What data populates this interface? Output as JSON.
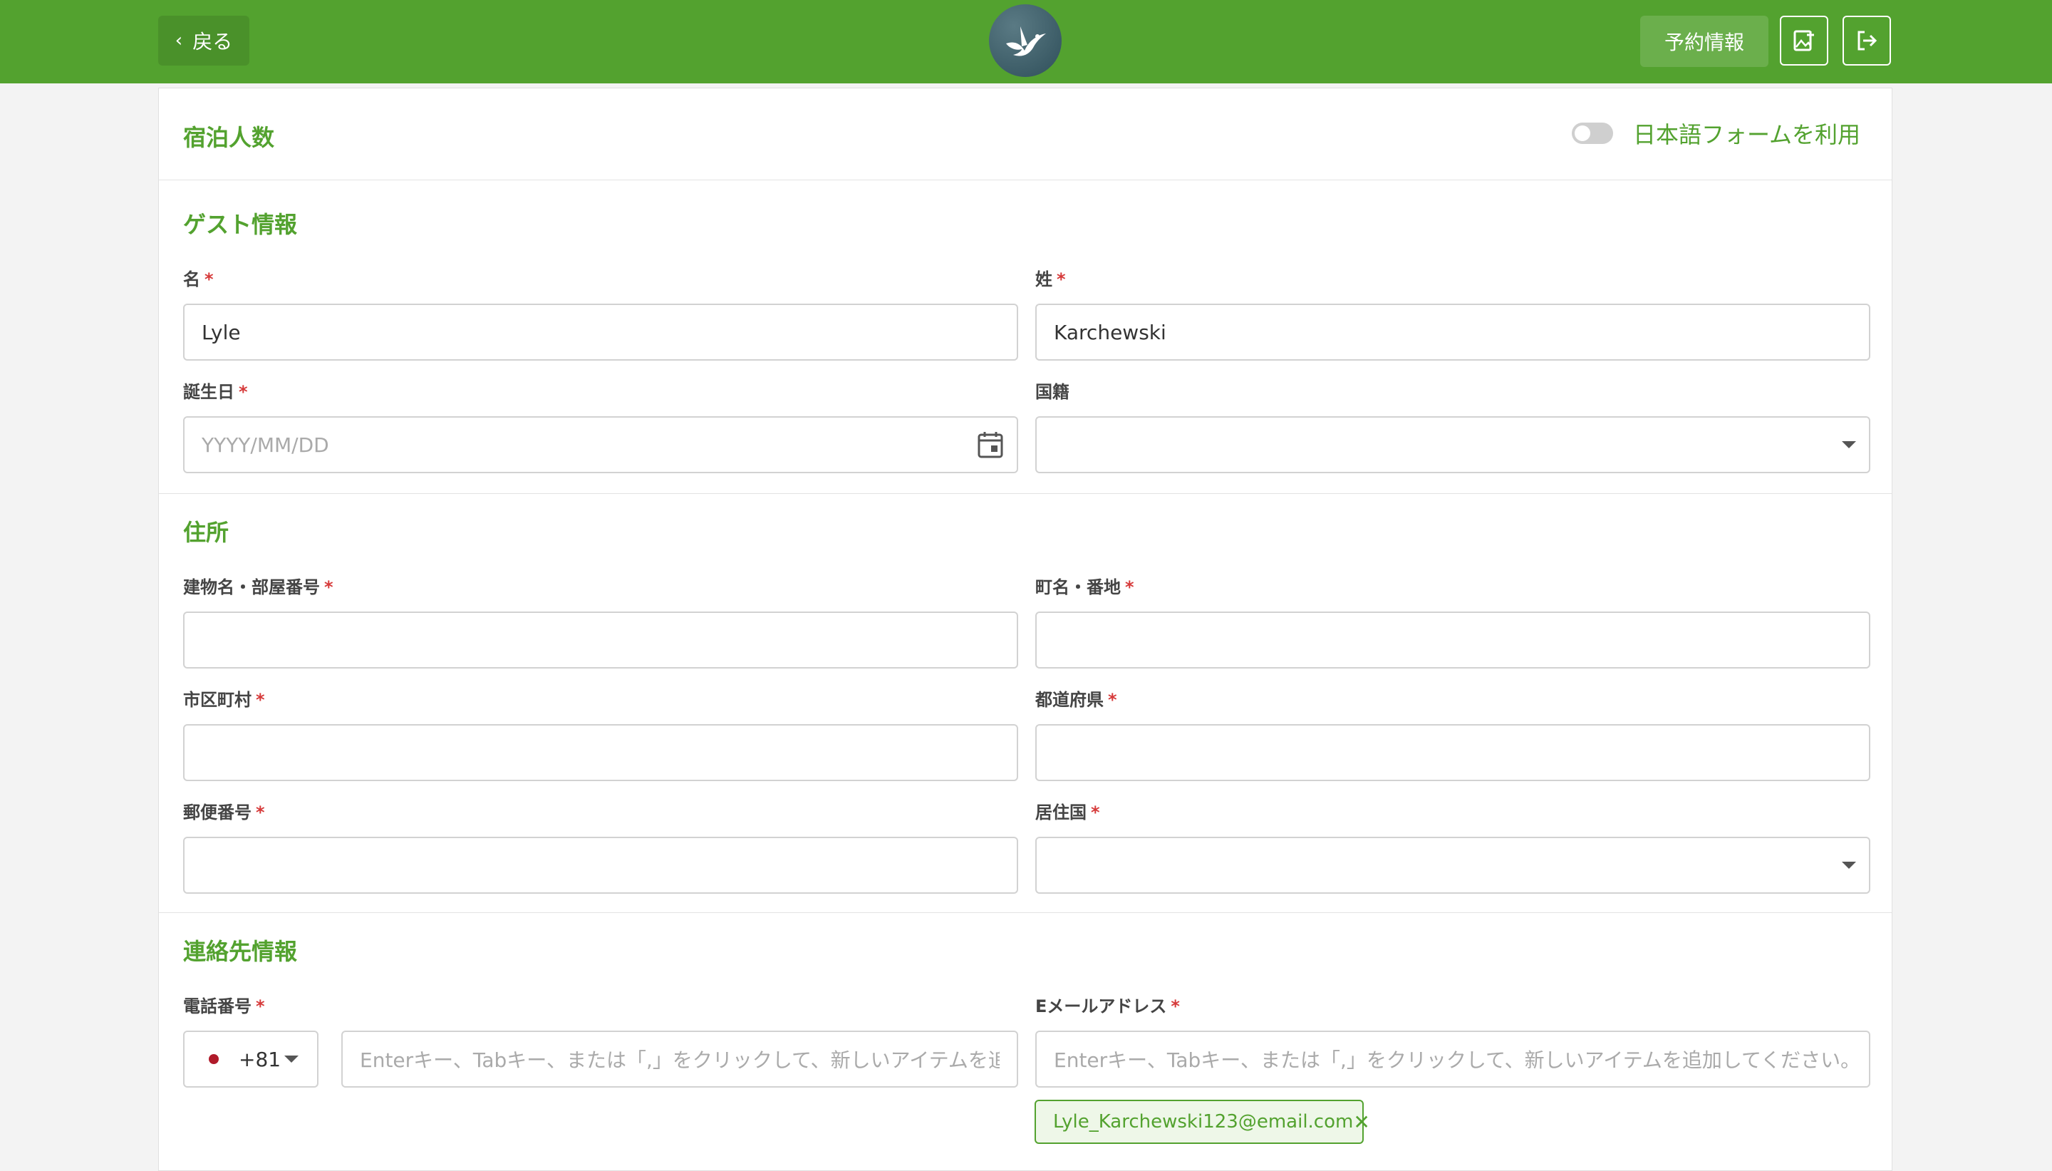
{
  "header": {
    "back_label": "戻る",
    "reservation_label": "予約情報",
    "colors": {
      "brand": "#53a22f"
    }
  },
  "sections": {
    "guests": {
      "title": "宿泊人数"
    },
    "guest_info": {
      "title": "ゲスト情報"
    },
    "address": {
      "title": "住所"
    },
    "contact": {
      "title": "連絡先情報"
    }
  },
  "toggle": {
    "label": "日本語フォームを利用"
  },
  "fields": {
    "first_name": {
      "label": "名",
      "value": "Lyle"
    },
    "last_name": {
      "label": "姓",
      "value": "Karchewski"
    },
    "birthdate": {
      "label": "誕生日",
      "placeholder": "YYYY/MM/DD"
    },
    "nationality": {
      "label": "国籍",
      "value": ""
    },
    "building": {
      "label": "建物名・部屋番号",
      "value": ""
    },
    "street": {
      "label": "町名・番地",
      "value": ""
    },
    "city": {
      "label": "市区町村",
      "value": ""
    },
    "prefecture": {
      "label": "都道府県",
      "value": ""
    },
    "postal": {
      "label": "郵便番号",
      "value": ""
    },
    "country": {
      "label": "居住国",
      "value": ""
    },
    "phone": {
      "label": "電話番号",
      "country_code": "+81",
      "placeholder": "Enterキー、Tabキー、または「,」をクリックして、新しいアイテムを追加してください。"
    },
    "email": {
      "label": "Eメールアドレス",
      "placeholder": "Enterキー、Tabキー、または「,」をクリックして、新しいアイテムを追加してください。",
      "chips": [
        "Lyle_Karchewski123@email.com"
      ]
    }
  },
  "required_mark": "*"
}
